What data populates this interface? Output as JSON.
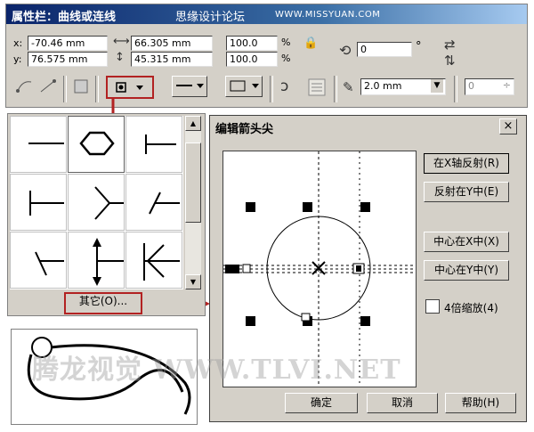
{
  "propbar": {
    "title": "属性栏：曲线或连线",
    "watermark_cn": "思缘设计论坛",
    "watermark_url": "WWW.MISSYUAN.COM",
    "x_label": "x:",
    "x_value": "-70.46 mm",
    "y_label": "y:",
    "y_value": "76.575 mm",
    "width_value": "66.305 mm",
    "height_value": "45.315 mm",
    "scale_x": "100.0",
    "scale_y": "100.0",
    "percent": "%",
    "angle_value": "0",
    "degree": "°",
    "outline_width": "2.0 mm",
    "counter_value": "0",
    "highlight_color": "#b22222"
  },
  "picker": {
    "other_label": "其它(O)..."
  },
  "dialog": {
    "title": "编辑箭头尖",
    "close": "×",
    "btn_mirror_x": "在X轴反射(R)",
    "btn_mirror_y": "反射在Y中(E)",
    "btn_center_x": "中心在X中(X)",
    "btn_center_y": "中心在Y中(Y)",
    "chk_4x": "4倍缩放(4)",
    "ok": "确定",
    "cancel": "取消",
    "help": "帮助(H)"
  },
  "watermark": "腾龙视觉 WWW.TLVI.NET"
}
